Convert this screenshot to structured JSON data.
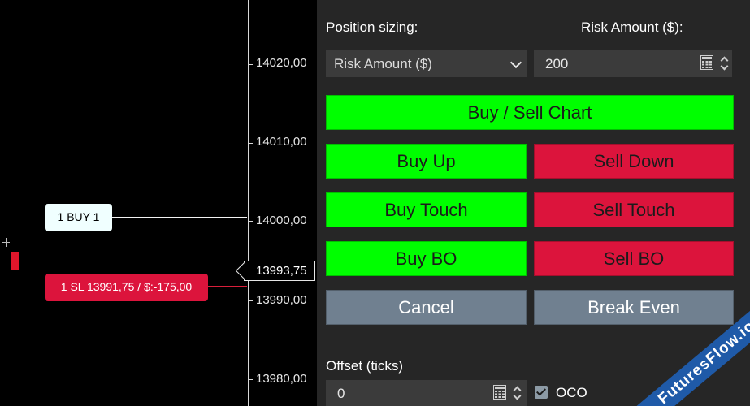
{
  "chart": {
    "price_labels": [
      "14020,00",
      "14010,00",
      "14000,00",
      "13990,00",
      "13980,00"
    ],
    "current_price": "13993,75",
    "orders": {
      "buy_label": "1 BUY 1",
      "sl_label": "1 SL 13991,75 / $:-175,00"
    }
  },
  "panel": {
    "position_sizing_label": "Position sizing:",
    "risk_amount_label": "Risk Amount ($):",
    "sizing_select_value": "Risk Amount ($)",
    "risk_amount_value": "200",
    "buttons": {
      "buy_sell_chart": "Buy / Sell Chart",
      "buy_up": "Buy Up",
      "sell_down": "Sell Down",
      "buy_touch": "Buy Touch",
      "sell_touch": "Sell Touch",
      "buy_bo": "Buy BO",
      "sell_bo": "Sell BO",
      "cancel": "Cancel",
      "break_even": "Break Even"
    },
    "offset_label": "Offset (ticks)",
    "offset_value": "0",
    "oco_label": "OCO",
    "oco_checked": true
  },
  "colors": {
    "buy_green": "#00ff00",
    "sell_red": "#dc143c",
    "neutral_grey": "#708090",
    "panel_bg": "#262626"
  },
  "watermark": "FuturesFlow.io"
}
